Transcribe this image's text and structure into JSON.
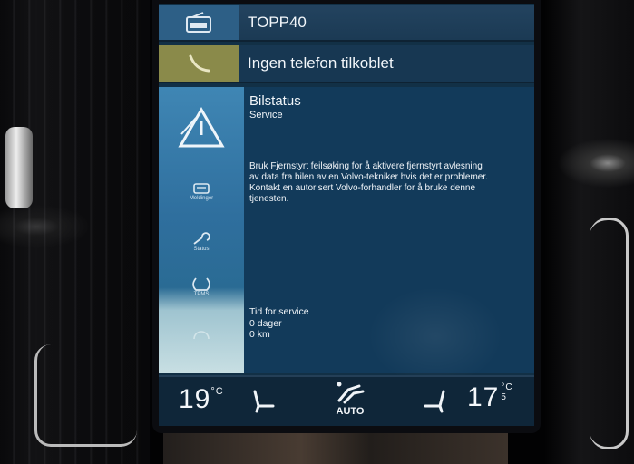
{
  "radio": {
    "station": "TOPP40",
    "icon": "radio-dab-icon"
  },
  "phone": {
    "status": "Ingen telefon tilkoblet",
    "icon": "phone-icon"
  },
  "side_menu": {
    "items": [
      {
        "icon": "warning-triangle-icon",
        "label": ""
      },
      {
        "icon": "car-icon",
        "label": "Meldinger"
      },
      {
        "icon": "wrench-icon",
        "label": "Status"
      },
      {
        "icon": "tire-pressure-icon",
        "label": "TPMS"
      },
      {
        "icon": "gauge-icon",
        "label": ""
      }
    ]
  },
  "card": {
    "title": "Bilstatus",
    "subtitle": "Service",
    "body": "Bruk Fjernstyrt feilsøking for å aktivere fjernstyrt avlesning av data fra bilen av en Volvo-tekniker hvis det er problemer. Kontakt en autorisert Volvo-forhandler for å bruke denne tjenesten.",
    "service": {
      "heading": "Tid for service",
      "days": "0 dager",
      "distance": "0 km"
    }
  },
  "climate": {
    "left_temp": "19",
    "left_unit": "°C",
    "right_temp": "17",
    "right_decimal": "5",
    "right_unit": "°C",
    "fan_mode": "AUTO",
    "colors": {
      "bar": "#0f2639",
      "text": "#f4f7fa"
    }
  }
}
